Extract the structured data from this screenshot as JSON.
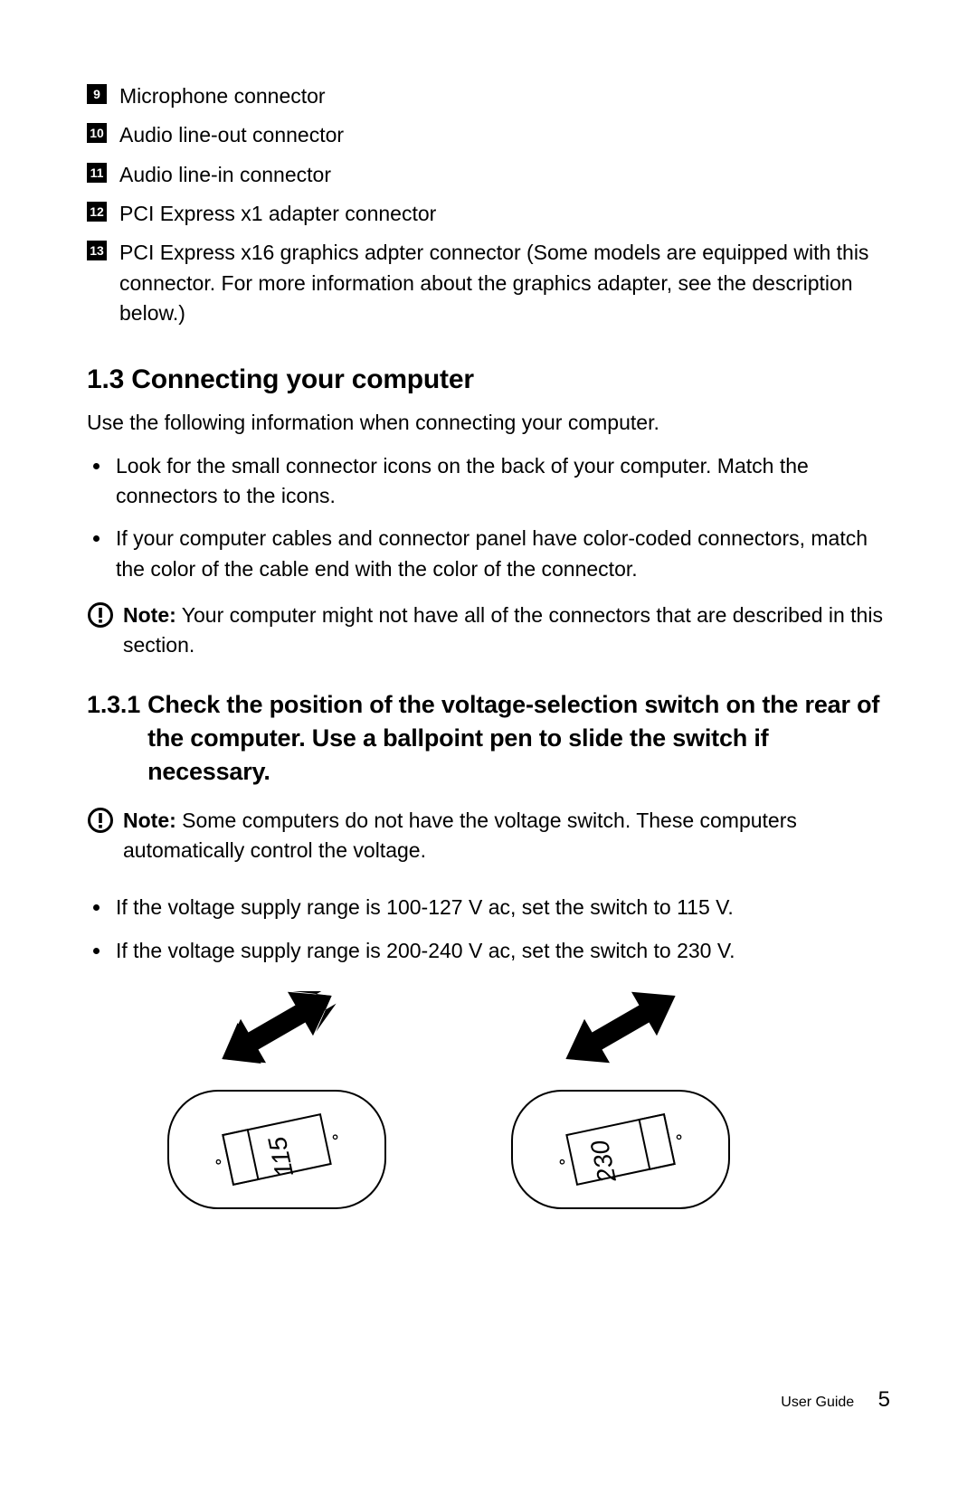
{
  "numbered": [
    {
      "n": "9",
      "text": "Microphone connector"
    },
    {
      "n": "10",
      "text": "Audio line-out connector"
    },
    {
      "n": "11",
      "text": "Audio line-in connector"
    },
    {
      "n": "12",
      "text": "PCI Express x1 adapter connector"
    },
    {
      "n": "13",
      "text": "PCI Express x16 graphics adpter connector (Some models are equipped with this connector. For more information about the graphics adapter, see the description below.)"
    }
  ],
  "section": {
    "heading": "1.3 Connecting your computer",
    "intro": "Use the following information when connecting your computer.",
    "bullets1": [
      "Look for the small connector icons on the back of your computer. Match the connectors to the icons.",
      "If your computer cables and connector panel have color-coded connectors, match the color of the cable end with the color of the connector."
    ],
    "note1_label": "Note:",
    "note1_text": " Your computer might not have all of the connectors that are described in this section.",
    "sub_num": "1.3.1",
    "sub_heading": "Check the position of the voltage-selection switch on the rear of the computer. Use a ballpoint pen to slide the switch if necessary.",
    "note2_label": "Note:",
    "note2_text": " Some computers do not have the voltage switch. These computers automatically control the voltage.",
    "bullets2": [
      "If the voltage supply range is 100-127 V ac, set the switch to 115 V.",
      "If the voltage supply range is 200-240 V ac, set the switch to 230 V."
    ],
    "switches": [
      "115",
      "230"
    ]
  },
  "footer": {
    "label": "User Guide",
    "page": "5"
  }
}
